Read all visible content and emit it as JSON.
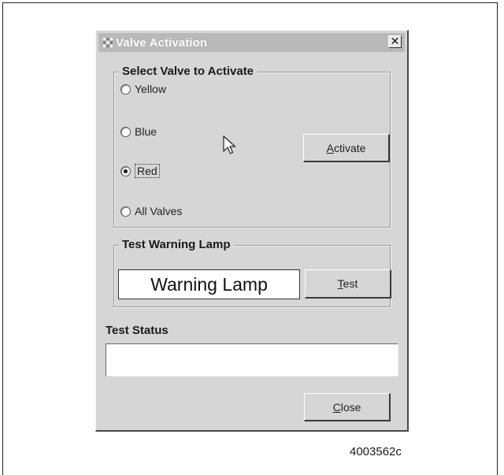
{
  "dialog": {
    "title": "Valve Activation",
    "close_glyph": "✕",
    "title_icon": "app-grid-icon"
  },
  "valve_group": {
    "legend": "Select Valve to Activate",
    "options": [
      {
        "label": "Yellow",
        "checked": false
      },
      {
        "label": "Blue",
        "checked": false
      },
      {
        "label": "Red",
        "checked": true
      },
      {
        "label": "All Valves",
        "checked": false
      }
    ],
    "activate_button": {
      "mnemonic": "A",
      "rest": "ctivate"
    }
  },
  "lamp_group": {
    "legend": "Test Warning Lamp",
    "lamp_label": "Warning Lamp",
    "test_button": {
      "mnemonic": "T",
      "rest": "est"
    }
  },
  "status": {
    "label": "Test Status",
    "value": ""
  },
  "close_button": {
    "mnemonic": "C",
    "rest": "lose"
  },
  "figure_id": "4003562c"
}
